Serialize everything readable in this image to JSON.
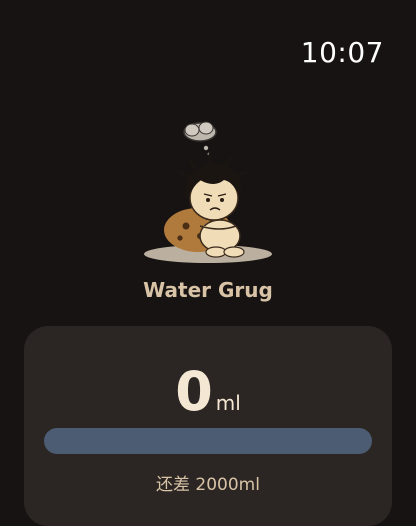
{
  "status_bar": {
    "time": "10:07"
  },
  "app": {
    "title": "Water Grug"
  },
  "mascot": {
    "icon": "caveman-worried-icon",
    "thought_icon": "thought-cloud-icon"
  },
  "intake": {
    "amount": "0",
    "unit": "ml",
    "progress_fraction": 0,
    "remaining_text": "还差 2000ml"
  },
  "colors": {
    "background": "#161312",
    "card": "#2b2623",
    "accent_text": "#d8c3a6",
    "progress_track": "#4c5c73"
  }
}
